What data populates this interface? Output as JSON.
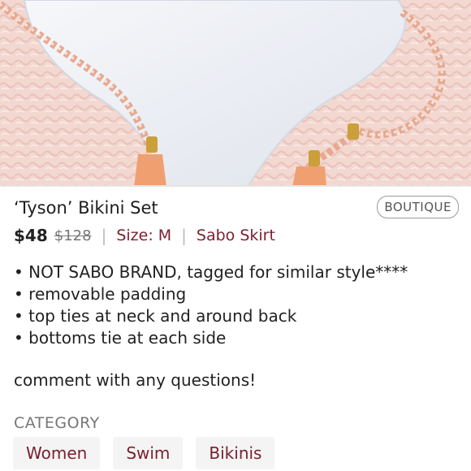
{
  "listing": {
    "title": "‘Tyson’ Bikini Set",
    "badge": "BOUTIQUE",
    "price": "$48",
    "original_price": "$128",
    "separator": "|",
    "size": "Size: M",
    "brand": "Sabo Skirt"
  },
  "description": {
    "lines": [
      "• NOT SABO BRAND, tagged for similar style****",
      "• removable padding",
      "• top ties at neck and around back",
      "• bottoms tie at each side"
    ],
    "comment": "comment with any questions!"
  },
  "category": {
    "label": "CATEGORY",
    "chips": [
      "Women",
      "Swim",
      "Bikinis"
    ]
  },
  "colors": {
    "accent": "#7a1f2e",
    "fur_background": "#f3d9d2",
    "bikini": "#eef1f6",
    "rope": "#e7a98f"
  },
  "photo": {
    "description_icon": "product-photo"
  }
}
